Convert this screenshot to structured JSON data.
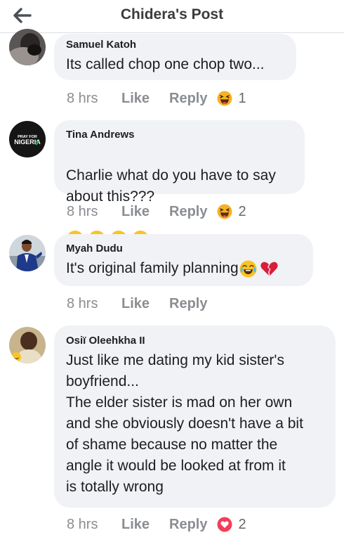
{
  "header": {
    "title": "Chidera's Post",
    "back_icon": "arrow-left-icon"
  },
  "comments": [
    {
      "author": "Samuel Katoh",
      "text": "Its called chop one chop two...",
      "time": "8 hrs",
      "like": "Like",
      "reply": "Reply",
      "reaction": {
        "icon": "haha-reaction-icon",
        "count": "1"
      }
    },
    {
      "author": "Tina Andrews",
      "text": "Charlie what do you have to say about this???",
      "emojis": "relieved-face x4",
      "avatar_text_top": "PRAY FOR",
      "avatar_text_bottom": "NIGERIA",
      "time": "8 hrs",
      "like": "Like",
      "reply": "Reply",
      "reaction": {
        "icon": "haha-reaction-icon",
        "count": "2"
      }
    },
    {
      "author": "Myah Dudu",
      "text": "It's original family planning",
      "emojis": "tears-of-joy, broken-heart",
      "time": "8 hrs",
      "like": "Like",
      "reply": "Reply"
    },
    {
      "author": "Osiï Oleehkha II",
      "text": "Just like me dating my kid sister's\nboyfriend...\nThe elder sister is mad on her own\nand she obviously doesn't have a bit\nof shame because no matter the\nangle it would be looked at from it\nis totally wrong",
      "time": "8 hrs",
      "like": "Like",
      "reply": "Reply",
      "reaction": {
        "icon": "love-reaction-icon",
        "count": "2"
      }
    }
  ],
  "colors": {
    "bubble": "#f0f2f5",
    "meta_text": "#8a8d91",
    "haha": "#f7b125",
    "love": "#f33e58"
  }
}
